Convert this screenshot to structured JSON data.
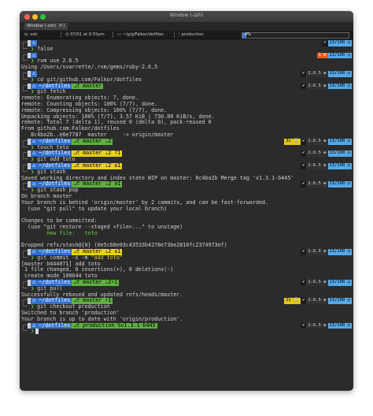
{
  "window": {
    "title": "Window (-zsh)"
  },
  "tab": {
    "label": "Window (-zsh)",
    "shortcut": "⌘1"
  },
  "statusbar": {
    "shell": "-zsh",
    "datetime": "07/01 at 9:55pm",
    "path": "~/g/g/Falkor/dotfiles",
    "branch": "production",
    "progress_text": "4%",
    "progress_value": 4
  },
  "colors": {
    "blue": "#2f6fcf",
    "green": "#5fb041",
    "yellow": "#d8d83a",
    "time": "#54a9e8",
    "error": "#e45c24"
  },
  "icons": {
    "apple": "apple-icon",
    "home": "home-icon",
    "git": "git-branch-icon",
    "check": "check-icon",
    "ruby": "ruby-icon",
    "clock": "clock-icon"
  },
  "lines": [
    {
      "type": "prompt_top",
      "dir": "",
      "git": "",
      "status": "✔",
      "ruby": "",
      "time": "13/100 ◷"
    },
    {
      "type": "cmd",
      "text": "false"
    },
    {
      "type": "prompt_top",
      "dir": "",
      "git": "",
      "err": "1 ✘",
      "time": "13/100 ◷"
    },
    {
      "type": "cmd",
      "text": "rvm use 2.6.5"
    },
    {
      "type": "text",
      "text": "Using /Users/svarrette/.rvm/gems/ruby-2.6.5"
    },
    {
      "type": "prompt_top",
      "dir": "",
      "git": "",
      "status": "✔",
      "ruby": "2.6.5 ◈",
      "time": "13/100 ◷"
    },
    {
      "type": "cmd",
      "text": "cd git/github.com/Falkor/dotfiles"
    },
    {
      "type": "prompt_top",
      "dir": "~/dotfiles",
      "git": "master",
      "status": "✔",
      "ruby": "2.6.5 ◈",
      "time": "13/100 ◷"
    },
    {
      "type": "cmd",
      "text": "git fetch"
    },
    {
      "type": "text",
      "text": "remote: Enumerating objects: 7, done."
    },
    {
      "type": "text",
      "text": "remote: Counting objects: 100% (7/7), done."
    },
    {
      "type": "text",
      "text": "remote: Compressing objects: 100% (7/7), done."
    },
    {
      "type": "text",
      "text": "Unpacking objects: 100% (7/7), 3.57 KiB | 730.00 KiB/s, done."
    },
    {
      "type": "text",
      "text": "remote: Total 7 (delta 1), reused 0 (delta 0), pack-reused 0"
    },
    {
      "type": "text",
      "text": "From github.com:Falkor/dotfiles"
    },
    {
      "type": "text",
      "text": "   8c4ba2b..e6e7787  master     -> origin/master"
    },
    {
      "type": "prompt_top",
      "dir": "~/dotfiles",
      "git": "master ⇣2",
      "dur": "3s ⌛",
      "status": "✔",
      "ruby": "2.6.5 ◈",
      "time": "13/100 ◷"
    },
    {
      "type": "cmd",
      "text": "touch toto"
    },
    {
      "type": "prompt_top",
      "dir": "~/dotfiles",
      "git": "master ⇣2 ?1",
      "dirty": true,
      "status": "✔",
      "ruby": "2.6.5 ◈",
      "time": "13/100 ◷"
    },
    {
      "type": "cmd",
      "text": "git add toto"
    },
    {
      "type": "prompt_top",
      "dir": "~/dotfiles",
      "git": "master ⇣2 ±1",
      "dirty": true,
      "status": "✔",
      "ruby": "2.6.5 ◈",
      "time": "13/100 ◷"
    },
    {
      "type": "cmd",
      "text": "git stash"
    },
    {
      "type": "text",
      "text": "Saved working directory and index state WIP on master: 8c4ba2b Merge tag 'v1.3.1-b445'"
    },
    {
      "type": "prompt_top",
      "dir": "~/dotfiles",
      "git": "master ⇣2 ≡1",
      "status": "✔",
      "ruby": "2.6.5 ◈",
      "time": "13/100 ◷"
    },
    {
      "type": "cmd",
      "text": "git stash pop"
    },
    {
      "type": "text",
      "text": "On branch master"
    },
    {
      "type": "text",
      "text": "Your branch is behind 'origin/master' by 2 commits, and can be fast-forwarded."
    },
    {
      "type": "text",
      "text": "  (use \"git pull\" to update your local branch)"
    },
    {
      "type": "text",
      "text": ""
    },
    {
      "type": "text",
      "text": "Changes to be committed:"
    },
    {
      "type": "text",
      "text": "  (use \"git restore --staged <file>...\" to unstage)"
    },
    {
      "type": "text_green",
      "text": "        new file:   toto"
    },
    {
      "type": "text",
      "text": ""
    },
    {
      "type": "text",
      "text": "Dropped refs/stash@{0} (0e5c68e03c43533b4278e73be2810fc2374973ef)"
    },
    {
      "type": "prompt_top",
      "dir": "~/dotfiles",
      "git": "master ⇣2 ±1",
      "dirty": true,
      "status": "✔",
      "ruby": "2.6.5 ◈",
      "time": "13/100 ◷"
    },
    {
      "type": "cmd_quoted",
      "text": "git commit -s -m ",
      "quote": "\"add toto\""
    },
    {
      "type": "text",
      "text": "[master b444071] add toto"
    },
    {
      "type": "text",
      "text": " 1 file changed, 0 insertions(+), 0 deletions(-)"
    },
    {
      "type": "text",
      "text": " create mode 100644 toto"
    },
    {
      "type": "prompt_top",
      "dir": "~/dotfiles",
      "git": "master ⇣2⇡1",
      "status": "✔",
      "ruby": "2.6.5 ◈",
      "time": "13/100 ◷"
    },
    {
      "type": "cmd",
      "text": "git pull"
    },
    {
      "type": "text",
      "text": "Successfully rebased and updated refs/heads/master."
    },
    {
      "type": "prompt_top",
      "dir": "~/dotfiles",
      "git": "master ⇡1",
      "dur": "2s ⌛",
      "status": "✔",
      "ruby": "2.6.5 ◈",
      "time": "13/100 ◷"
    },
    {
      "type": "cmd",
      "text": "git checkout production"
    },
    {
      "type": "text",
      "text": "Switched to branch 'production'"
    },
    {
      "type": "text",
      "text": "Your branch is up to date with 'origin/production'."
    },
    {
      "type": "prompt_top",
      "dir": "~/dotfiles",
      "git": "production %v1.3.1-b445",
      "status": "✔",
      "ruby": "2.6.5 ◈",
      "time": "13/100 ◷"
    },
    {
      "type": "input",
      "text": ""
    }
  ]
}
